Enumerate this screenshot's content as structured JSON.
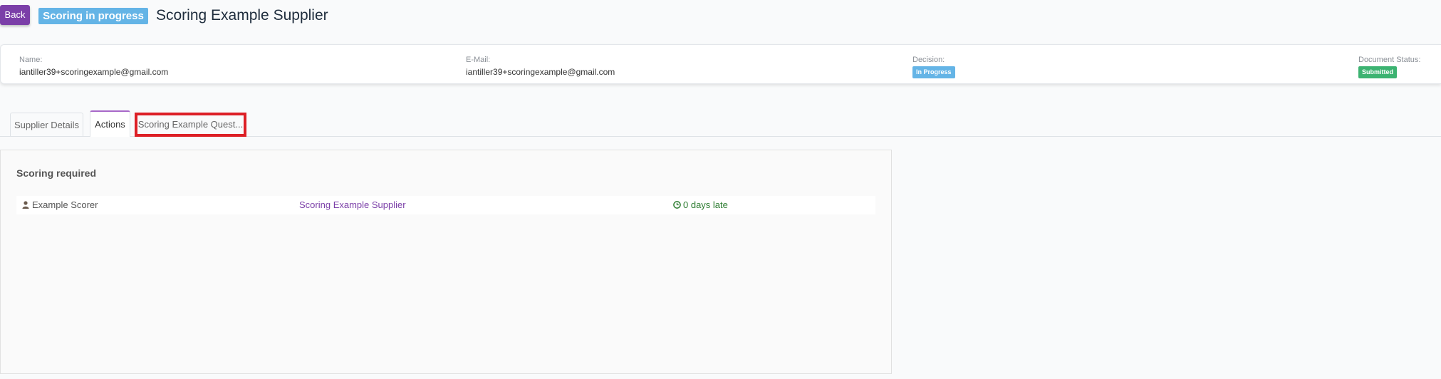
{
  "header": {
    "back_label": "Back",
    "status_label": "Scoring in progress",
    "title": "Scoring Example Supplier"
  },
  "info": {
    "name_label": "Name:",
    "name_value": "iantiller39+scoringexample@gmail.com",
    "email_label": "E-Mail:",
    "email_value": "iantiller39+scoringexample@gmail.com",
    "decision_label": "Decision:",
    "decision_value": "In Progress",
    "doc_status_label": "Document Status:",
    "doc_status_value": "Submitted"
  },
  "tabs": [
    {
      "label": "Supplier Details"
    },
    {
      "label": "Actions"
    },
    {
      "label": "Scoring Example Quest..."
    }
  ],
  "panel": {
    "title": "Scoring required",
    "rows": [
      {
        "scorer": "Example Scorer",
        "supplier": "Scoring Example Supplier",
        "due": "0 days late"
      }
    ]
  },
  "colors": {
    "accent": "#7b3fa8",
    "status_blue": "#64b4e6",
    "status_green": "#3cb371",
    "highlight_red": "#dd1f26",
    "late_green": "#2e7d32"
  },
  "icons": {
    "scorer": "user-icon",
    "due": "clock-icon"
  }
}
